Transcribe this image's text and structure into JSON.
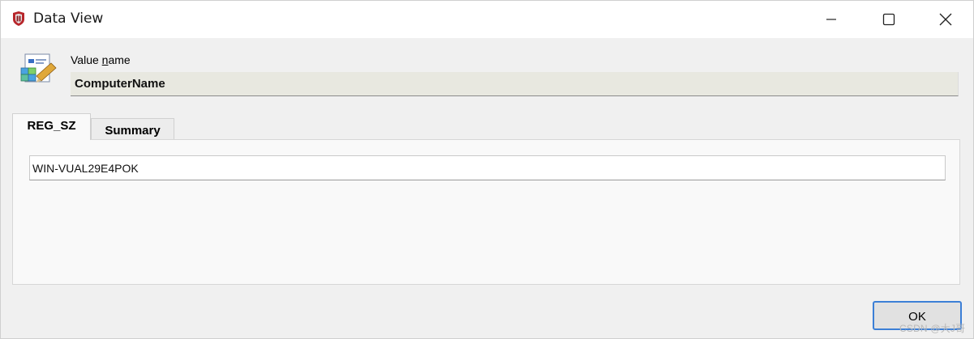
{
  "window": {
    "title": "Data View",
    "icons": {
      "app": "registry-app-icon",
      "minimize": "minimize-icon",
      "maximize": "maximize-icon",
      "close": "close-icon"
    }
  },
  "value_name": {
    "label_prefix": "Value ",
    "label_underlined": "n",
    "label_suffix": "ame",
    "value": "ComputerName",
    "icon": "registry-value-icon"
  },
  "tabs": [
    {
      "label": "REG_SZ",
      "active": true
    },
    {
      "label": "Summary",
      "active": false
    }
  ],
  "panel": {
    "string_value": "WIN-VUAL29E4POK"
  },
  "buttons": {
    "ok": "OK"
  },
  "watermark": "CSDN @大J哥",
  "colors": {
    "accent_border": "#3c7fd6",
    "window_bg": "#f0f0f0",
    "titlebar_bg": "#ffffff",
    "value_box_bg": "#e8e8e0"
  }
}
